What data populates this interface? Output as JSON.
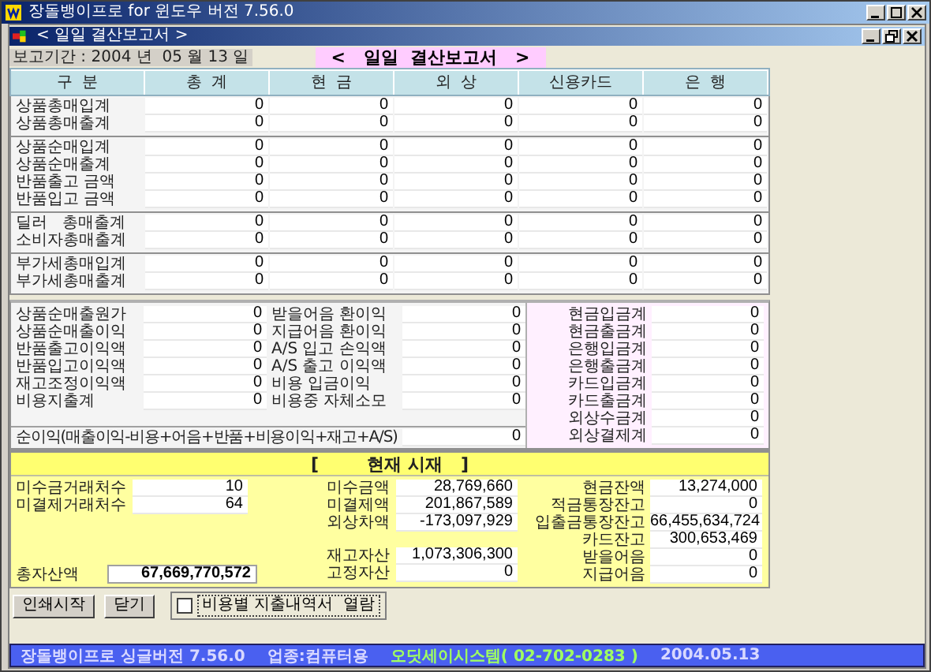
{
  "app_title": "장돌뱅이프로 for 윈도우 버전 7.56.0",
  "child_title": "< 일일 결산보고서 >",
  "report_period": "보고기간 : 2004 년  05 월 13 일",
  "report_title": "<   일일  결산보고서   >",
  "table": {
    "columns": [
      "구  분",
      "총  계",
      "현  금",
      "외  상",
      "신용카드",
      "은  행"
    ],
    "groups": [
      {
        "rows": [
          {
            "label": "상품총매입계",
            "values": [
              "0",
              "0",
              "0",
              "0",
              "0"
            ]
          },
          {
            "label": "상품총매출계",
            "values": [
              "0",
              "0",
              "0",
              "0",
              "0"
            ]
          }
        ]
      },
      {
        "rows": [
          {
            "label": "상품순매입계",
            "values": [
              "0",
              "0",
              "0",
              "0",
              "0"
            ]
          },
          {
            "label": "상품순매출계",
            "values": [
              "0",
              "0",
              "0",
              "0",
              "0"
            ]
          },
          {
            "label": "반품출고 금액",
            "values": [
              "0",
              "0",
              "0",
              "0",
              "0"
            ]
          },
          {
            "label": "반품입고 금액",
            "values": [
              "0",
              "0",
              "0",
              "0",
              "0"
            ]
          }
        ]
      },
      {
        "rows": [
          {
            "label": "딜러   총매출계",
            "values": [
              "0",
              "0",
              "0",
              "0",
              "0"
            ]
          },
          {
            "label": "소비자총매출계",
            "values": [
              "0",
              "0",
              "0",
              "0",
              "0"
            ]
          }
        ]
      },
      {
        "rows": [
          {
            "label": "부가세총매입계",
            "values": [
              "0",
              "0",
              "0",
              "0",
              "0"
            ]
          },
          {
            "label": "부가세총매출계",
            "values": [
              "0",
              "0",
              "0",
              "0",
              "0"
            ]
          }
        ]
      }
    ]
  },
  "profit": {
    "left": [
      {
        "label": "상품순매출원가",
        "value": "0"
      },
      {
        "label": "상품순매출이익",
        "value": "0"
      },
      {
        "label": "반품출고이익액",
        "value": "0"
      },
      {
        "label": "반품입고이익액",
        "value": "0"
      },
      {
        "label": "재고조정이익액",
        "value": "0"
      },
      {
        "label": "비용지출계",
        "value": "0"
      }
    ],
    "middle": [
      {
        "label": "받을어음 환이익",
        "value": "0"
      },
      {
        "label": "지급어음 환이익",
        "value": "0"
      },
      {
        "label": "A/S 입고 손익액",
        "value": "0"
      },
      {
        "label": "A/S 출고 이익액",
        "value": "0"
      },
      {
        "label": "비용 입금이익",
        "value": "0"
      },
      {
        "label": "비용중 자체소모",
        "value": "0"
      }
    ],
    "right": [
      {
        "label": "현금입금계",
        "value": "0"
      },
      {
        "label": "현금출금계",
        "value": "0"
      },
      {
        "label": "은행입금계",
        "value": "0"
      },
      {
        "label": "은행출금계",
        "value": "0"
      },
      {
        "label": "카드입금계",
        "value": "0"
      },
      {
        "label": "카드출금계",
        "value": "0"
      },
      {
        "label": "외상수금계",
        "value": "0"
      },
      {
        "label": "외상결제계",
        "value": "0"
      }
    ],
    "net_profit": {
      "label": "순이익(매출이익-비용+어음+반품+비용이익+재고+A/S)",
      "value": "0"
    }
  },
  "current": {
    "title": "[        현재 시재   ]",
    "counts": [
      {
        "label": "미수금거래처수",
        "value": "10"
      },
      {
        "label": "미결제거래처수",
        "value": "64"
      }
    ],
    "total_assets": {
      "label": "총자산액",
      "value": "67,669,770,572"
    },
    "receivables": [
      {
        "label": "미수금액",
        "value": "28,769,660"
      },
      {
        "label": "미결제액",
        "value": "201,867,589"
      },
      {
        "label": "외상차액",
        "value": "-173,097,929"
      }
    ],
    "assets": [
      {
        "label": "재고자산",
        "value": "1,073,306,300"
      },
      {
        "label": "고정자산",
        "value": "0"
      }
    ],
    "balances": [
      {
        "label": "현금잔액",
        "value": "13,274,000"
      },
      {
        "label": "적금통장잔고",
        "value": "0"
      },
      {
        "label": "입출금통장잔고",
        "value": "66,455,634,724"
      },
      {
        "label": "카드잔고",
        "value": "300,653,469"
      },
      {
        "label": "받을어음",
        "value": "0"
      },
      {
        "label": "지급어음",
        "value": "0"
      }
    ]
  },
  "buttons": [
    "인쇄시작",
    "닫기"
  ],
  "checkbox": {
    "label": "비용별 지출내역서  열람",
    "checked": false
  },
  "status_bar": {
    "product": "장돌뱅이프로 싱글버전 7.56.0",
    "industry": "업종:컴퓨터용",
    "company": "오딧세이시스템( 02-702-0283 )",
    "date": "2004.05.13"
  }
}
